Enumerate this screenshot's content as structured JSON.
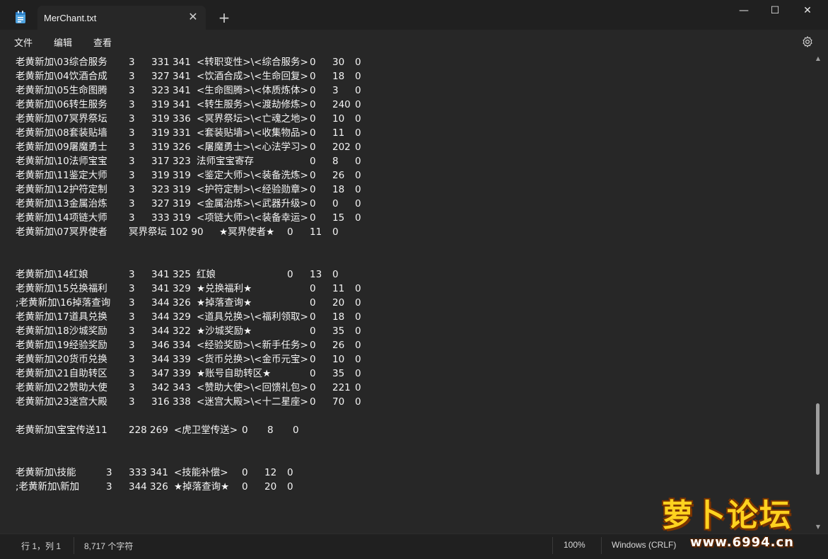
{
  "window": {
    "tab_title": "MerChant.txt",
    "tab_close": "✕",
    "new_tab": "+",
    "minimize": "—",
    "maximize": "☐",
    "close": "✕"
  },
  "menu": {
    "file": "文件",
    "edit": "编辑",
    "view": "查看"
  },
  "lines": [
    {
      "c": [
        "老黄新加\\03综合服务",
        "3",
        "331 341",
        "<转职变性>\\<综合服务>",
        "0",
        "30",
        "0"
      ]
    },
    {
      "c": [
        "老黄新加\\04饮酒合成",
        "3",
        "327 341",
        "<饮酒合成>\\<生命回复>",
        "0",
        "18",
        "0"
      ]
    },
    {
      "c": [
        "老黄新加\\05生命图腾",
        "3",
        "323 341",
        "<生命图腾>\\<体质炼体>",
        "0",
        "3",
        "0"
      ]
    },
    {
      "c": [
        "老黄新加\\06转生服务",
        "3",
        "319 341",
        "<转生服务>\\<渡劫修炼>",
        "0",
        "240",
        "0"
      ]
    },
    {
      "c": [
        "老黄新加\\07冥界祭坛",
        "3",
        "319 336",
        "<冥界祭坛>\\<亡魂之地>",
        "0",
        "10",
        "0"
      ]
    },
    {
      "c": [
        "老黄新加\\08套装贴墙",
        "3",
        "319 331",
        "<套装贴墙>\\<收集物品>",
        "0",
        "11",
        "0"
      ]
    },
    {
      "c": [
        "老黄新加\\09屠魔勇士",
        "3",
        "319 326",
        "<屠魔勇士>\\<心法学习>",
        "0",
        "202",
        "0"
      ]
    },
    {
      "c": [
        "老黄新加\\10法师宝宝",
        "3",
        "317 323",
        "法师宝宝寄存",
        "0",
        "8",
        "0"
      ]
    },
    {
      "c": [
        "老黄新加\\11鉴定大师",
        "3",
        "319 319",
        "<鉴定大师>\\<装备洗炼>",
        "0",
        "26",
        "0"
      ]
    },
    {
      "c": [
        "老黄新加\\12护符定制",
        "3",
        "323 319",
        "<护符定制>\\<经验勋章>",
        "0",
        "18",
        "0"
      ]
    },
    {
      "c": [
        "老黄新加\\13金属治炼",
        "3",
        "327 319",
        "<金属治炼>\\<武器升级>",
        "0",
        "0",
        "0"
      ]
    },
    {
      "c": [
        "老黄新加\\14项链大师",
        "3",
        "333 319",
        "<项链大师>\\<装备幸运>",
        "0",
        "15",
        "0"
      ]
    },
    {
      "c": [
        "老黄新加\\07冥界使者",
        "冥界祭坛 102 90",
        "★冥界使者★",
        "0",
        "11",
        "0"
      ],
      "alt": true
    },
    {
      "c": []
    },
    {
      "c": []
    },
    {
      "c": [
        "老黄新加\\14红娘",
        "3",
        "341 325",
        "红娘",
        "0",
        "13",
        "0"
      ],
      "alt2": true
    },
    {
      "c": [
        "老黄新加\\15兑换福利",
        "3",
        "341 329",
        "★兑换福利★",
        "0",
        "11",
        "0"
      ]
    },
    {
      "c": [
        ";老黄新加\\16掉落查询",
        "3",
        "344 326",
        "★掉落查询★",
        "0",
        "20",
        "0"
      ]
    },
    {
      "c": [
        "老黄新加\\17道具兑换",
        "3",
        "344 329",
        "<道具兑换>\\<福利领取>",
        "0",
        "18",
        "0"
      ]
    },
    {
      "c": [
        "老黄新加\\18沙城奖励",
        "3",
        "344 322",
        "★沙城奖励★",
        "0",
        "35",
        "0"
      ]
    },
    {
      "c": [
        "老黄新加\\19经验奖励",
        "3",
        "346 334",
        "<经验奖励>\\<新手任务>",
        "0",
        "26",
        "0"
      ]
    },
    {
      "c": [
        "老黄新加\\20货币兑换",
        "3",
        "344 339",
        "<货币兑换>\\<金币元宝>",
        "0",
        "10",
        "0"
      ]
    },
    {
      "c": [
        "老黄新加\\21自助转区",
        "3",
        "347 339",
        "★账号自助转区★",
        "0",
        "35",
        "0"
      ]
    },
    {
      "c": [
        "老黄新加\\22赞助大使",
        "3",
        "342 343",
        "<赞助大使>\\<回馈礼包>",
        "0",
        "221",
        "0"
      ]
    },
    {
      "c": [
        "老黄新加\\23迷宫大殿",
        "3",
        "316 338",
        "<迷宫大殿>\\<十二星座>",
        "0",
        "70",
        "0"
      ]
    },
    {
      "c": []
    },
    {
      "c": [
        "老黄新加\\宝宝传送11",
        "228 269",
        "<虎卫堂传送>",
        "0",
        "8",
        "0"
      ],
      "alt3": true
    },
    {
      "c": []
    },
    {
      "c": []
    },
    {
      "c": [
        "老黄新加\\技能",
        "3",
        "333 341",
        "<技能补偿>",
        "0",
        "12",
        "0"
      ],
      "alt4": true
    },
    {
      "c": [
        ";老黄新加\\新加",
        "3",
        "344 326",
        "★掉落查询★",
        "0",
        "20",
        "0"
      ],
      "alt4": true
    }
  ],
  "status": {
    "position": "行 1，列 1",
    "char_count": "8,717 个字符",
    "zoom": "100%",
    "line_ending": "Windows (CRLF)"
  },
  "watermark": {
    "chars": "萝卜论坛",
    "url": "www.6994.cn"
  },
  "colors": {
    "accent": "#ffd21f"
  }
}
